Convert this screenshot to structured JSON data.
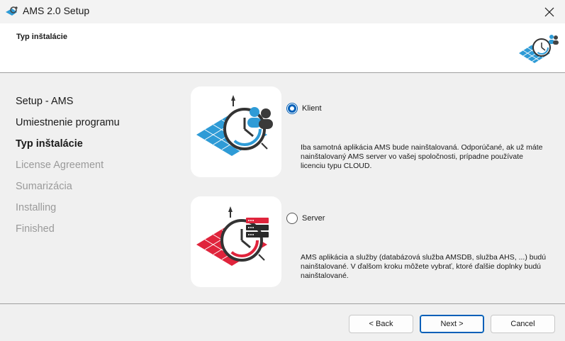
{
  "window": {
    "title": "AMS 2.0 Setup"
  },
  "header": {
    "page_title": "Typ inštalácie"
  },
  "steps": [
    {
      "label": "Setup - AMS",
      "state": "done"
    },
    {
      "label": "Umiestnenie programu",
      "state": "done"
    },
    {
      "label": "Typ inštalácie",
      "state": "active"
    },
    {
      "label": "License Agreement",
      "state": "pending"
    },
    {
      "label": "Sumarizácia",
      "state": "pending"
    },
    {
      "label": "Installing",
      "state": "pending"
    },
    {
      "label": "Finished",
      "state": "pending"
    }
  ],
  "options": {
    "klient": {
      "label": "Klient",
      "selected": true,
      "description": "Iba samotná aplikácia AMS bude nainštalovaná. Odporúčané, ak už máte nainštalovaný AMS server vo vašej spoločnosti, prípadne používate licenciu typu CLOUD.",
      "icon": "ams-client-illustration",
      "accent": "#2e9bd6"
    },
    "server": {
      "label": "Server",
      "selected": false,
      "description": "AMS aplikácia a služby (databázová služba AMSDB, služba AHS, ...) budú nainštalované. V ďalšom kroku môžete vybrať, ktoré ďalšie doplnky budú nainštalované.",
      "icon": "ams-server-illustration",
      "accent": "#e0243c"
    }
  },
  "buttons": {
    "back": "< Back",
    "next": "Next >",
    "cancel": "Cancel"
  },
  "colors": {
    "accent": "#005fb8",
    "client_blue": "#2e9bd6",
    "server_red": "#e0243c"
  }
}
